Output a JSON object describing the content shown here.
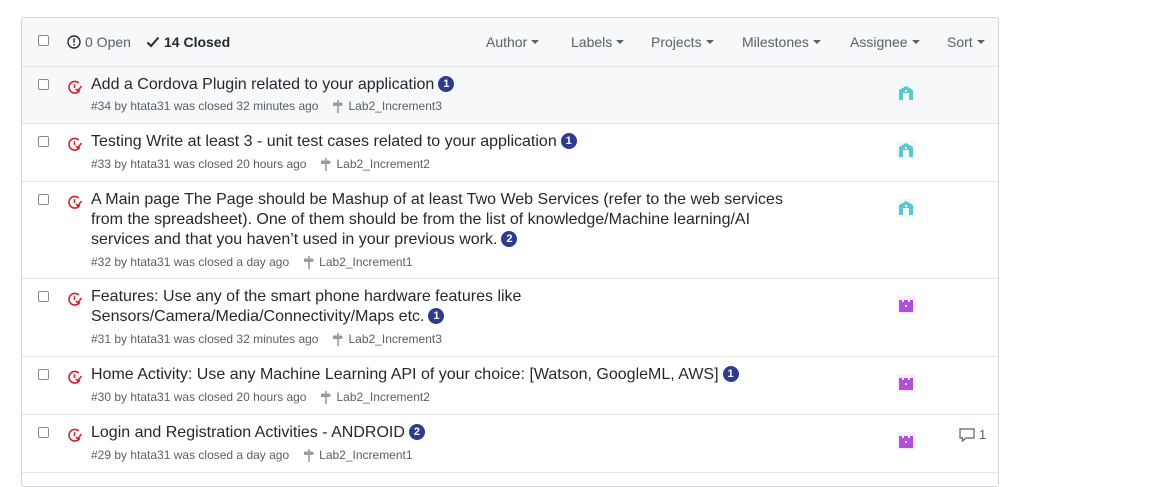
{
  "header": {
    "open_count": "0 Open",
    "closed_count": "14 Closed",
    "filters": {
      "author": "Author",
      "labels": "Labels",
      "projects": "Projects",
      "milestones": "Milestones",
      "assignee": "Assignee",
      "sort": "Sort"
    }
  },
  "issues": [
    {
      "title": "Add a Cordova Plugin related to your application",
      "tasks": "1",
      "meta": "#34 by htata31 was closed 32 minutes ago",
      "milestone": "Lab2_Increment3"
    },
    {
      "title": "Testing Write at least 3 - unit test cases related to your application",
      "tasks": "1",
      "meta": "#33 by htata31 was closed 20 hours ago",
      "milestone": "Lab2_Increment2"
    },
    {
      "title": "A Main page The Page should be Mashup of at least Two Web Services (refer to the web services from the spreadsheet). One of them should be from the list of knowledge/Machine learning/AI services and that you haven’t used in your previous work.",
      "tasks": "2",
      "meta": "#32 by htata31 was closed a day ago",
      "milestone": "Lab2_Increment1"
    },
    {
      "title": "Features: Use any of the smart phone hardware features like Sensors/Camera/Media/Connectivity/Maps etc.",
      "tasks": "1",
      "meta": "#31 by htata31 was closed 32 minutes ago",
      "milestone": "Lab2_Increment3"
    },
    {
      "title": "Home Activity: Use any Machine Learning API of your choice: [Watson, GoogleML, AWS]",
      "tasks": "1",
      "meta": "#30 by htata31 was closed 20 hours ago",
      "milestone": "Lab2_Increment2"
    },
    {
      "title": "Login and Registration Activities - ANDROID",
      "tasks": "2",
      "meta": "#29 by htata31 was closed a day ago",
      "milestone": "Lab2_Increment1",
      "comments": "1"
    }
  ],
  "colors": {
    "closed_icon": "#cb2431",
    "task_badge": "#2f3b8f",
    "avatar_teal": "#5cc7d1",
    "avatar_purple": "#b04fd9"
  }
}
